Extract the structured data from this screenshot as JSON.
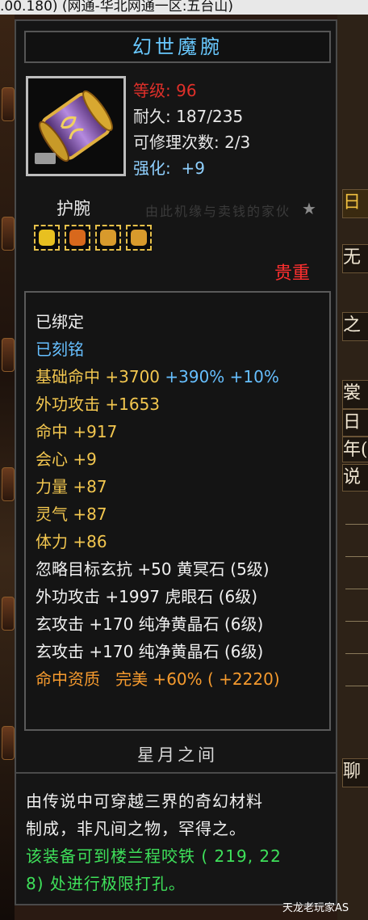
{
  "top_bar": {
    "text": ".00.180) (网通-华北网通一区:五台山)"
  },
  "item": {
    "name": "幻世魔腕",
    "level": "等级: 96",
    "durability": "耐久: 187/235",
    "repairs": "可修理次数: 2/3",
    "enhance_label": "强化:",
    "enhance_value": "+9",
    "slot": "护腕",
    "faded_text": "由此机缘与卖钱的家伙",
    "rarity": "贵重",
    "icon": "purple-gold-bracer-icon"
  },
  "gems": [
    {
      "icon": "yellow-gem-icon",
      "color": "#e8c020"
    },
    {
      "icon": "amber-gem-icon",
      "color": "#d8681c"
    },
    {
      "icon": "tiger-gem-icon",
      "color": "#d89a2c"
    },
    {
      "icon": "tiger-gem-icon",
      "color": "#d89a2c"
    },
    {
      "icon": "tiger-gem-icon",
      "color": "#d89a2c"
    }
  ],
  "attributes": {
    "bound": "已绑定",
    "engraved": "已刻铭",
    "hit_base_label": "基础命中",
    "hit_base_value": "+3700",
    "hit_base_extra": "+390% +10%",
    "ext_attack": "外功攻击  +1653",
    "hit": "命中  +917",
    "crit": "会心  +9",
    "strength": "力量  +87",
    "spirit": "灵气  +87",
    "stamina": "体力  +86",
    "gem1": "忽略目标玄抗  +50  黄冥石 (5级)",
    "gem2": "外功攻击  +1997  虎眼石 (6级)",
    "gem3": "玄攻击  +170  纯净黄晶石 (6级)",
    "gem4": "玄攻击  +170  纯净黄晶石 (6级)",
    "quality_label": "命中资质",
    "quality_value": "完美  +60% ( +2220)"
  },
  "section_title": "星月之间",
  "description": {
    "line1": "由传说中可穿越三界的奇幻材料",
    "line2": "制成，非凡间之物，罕得之。",
    "line3": "该装备可到楼兰程咬铁 ( 219, 22",
    "line4": "8) 处进行极限打孔。"
  },
  "side_panel": {
    "r1": "日",
    "r2": "无",
    "r3": "之",
    "r4": "裳",
    "r5": "日",
    "r6": "年(",
    "r7": "说",
    "r8": "聊"
  },
  "watermark": "天龙老玩家AS"
}
